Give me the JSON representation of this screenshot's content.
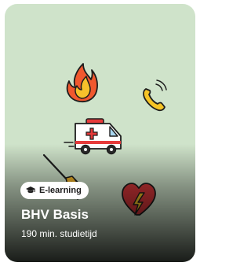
{
  "card": {
    "badge_label": "E-learning",
    "badge_icon": "graduation-cap-icon",
    "title": "BHV Basis",
    "subtitle": "190 min. studietijd",
    "background_color": "#cfe3ca"
  }
}
